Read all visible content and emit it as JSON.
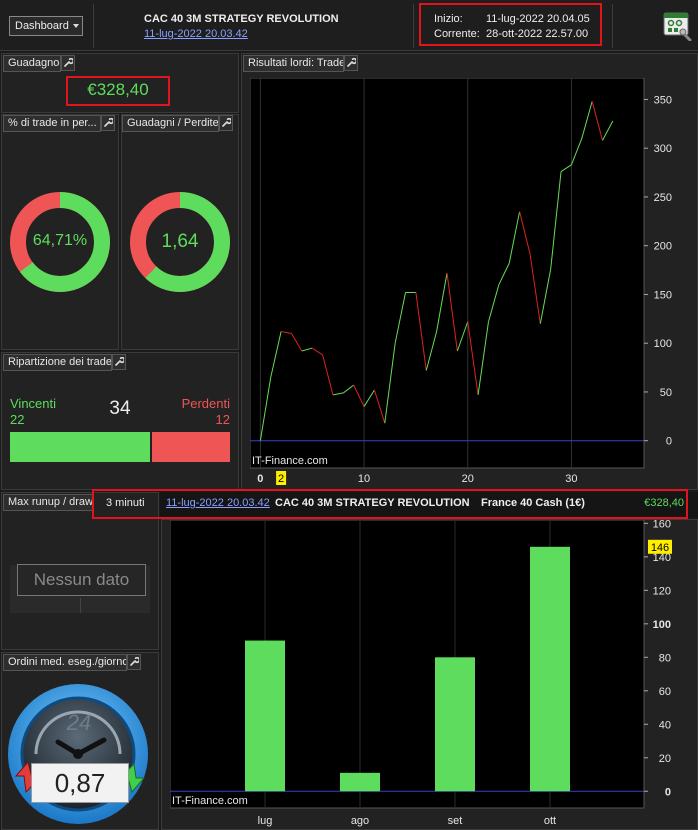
{
  "header": {
    "dashboard_label": "Dashboard",
    "strategy_name": "CAC 40 3M STRATEGY REVOLUTION",
    "strategy_date": "11-lug-2022 20.03.42",
    "inizio_label": "Inizio:",
    "inizio_value": "11-lug-2022 20.04.05",
    "corrente_label": "Corrente:",
    "corrente_value": "28-ott-2022 22.57.00"
  },
  "guadagno": {
    "title": "Guadagno",
    "value": "€328,40"
  },
  "pct_trade": {
    "title": "% di trade in per...",
    "value": "64,71%",
    "fraction": 0.6471
  },
  "guadagni_perdite": {
    "title": "Guadagni / Perdite",
    "value": "1,64",
    "fraction": 0.621
  },
  "ripartizione": {
    "title": "Ripartizione dei trade",
    "vincenti_label": "Vincenti",
    "vincenti_value": "22",
    "total": "34",
    "perdenti_label": "Perdenti",
    "perdenti_value": "12",
    "win_fraction": 0.647
  },
  "runup": {
    "title": "Max runup / draw",
    "empty_label": "Nessun dato"
  },
  "ordini": {
    "title": "Ordini med. eseg./giorno",
    "value": "0,87",
    "clock_label": "24"
  },
  "info_bar": {
    "timeframe": "3 minuti",
    "date": "11-lug-2022 20.03.42",
    "strategy": "CAC 40 3M STRATEGY REVOLUTION",
    "instrument": "France 40 Cash (1€)",
    "value": "€328,40"
  },
  "trade_chart_panel": {
    "title": "Risultati lordi: Trade"
  },
  "colors": {
    "green": "#5ddc5d",
    "red": "#f05555",
    "accent_red": "#e0151b",
    "link": "#8aa0ff"
  },
  "chart_data": [
    {
      "type": "line",
      "x": [
        0,
        1,
        2,
        3,
        4,
        5,
        6,
        7,
        8,
        9,
        10,
        11,
        12,
        13,
        14,
        15,
        16,
        17,
        18,
        19,
        20,
        21,
        22,
        23,
        24,
        25,
        26,
        27,
        28,
        29,
        30,
        31,
        32,
        33,
        34
      ],
      "y": [
        0,
        65,
        112,
        110,
        92,
        95,
        88,
        47,
        49,
        57,
        35,
        52,
        18,
        100,
        152,
        152,
        72,
        112,
        172,
        92,
        122,
        47,
        122,
        160,
        182,
        235,
        192,
        120,
        176,
        276,
        283,
        310,
        348,
        308,
        328
      ],
      "xticks": [
        0,
        10,
        20,
        30
      ],
      "yticks": [
        0,
        50,
        100,
        150,
        200,
        250,
        300,
        350
      ],
      "ylim": [
        -28,
        372
      ],
      "xlim": [
        -1,
        37
      ],
      "highlight_tick": "2",
      "watermark": "IT-Finance.com",
      "up_color": "#66dd55",
      "down_color": "#dd2222"
    },
    {
      "type": "bar",
      "categories": [
        "lug",
        "ago",
        "set",
        "ott"
      ],
      "values": [
        90,
        11,
        80,
        146
      ],
      "yticks": [
        0,
        20,
        40,
        60,
        80,
        100,
        120,
        140,
        160
      ],
      "ylim": [
        -10,
        162
      ],
      "highlight_label": "146",
      "watermark": "IT-Finance.com",
      "bar_color": "#5ddc5d"
    }
  ]
}
